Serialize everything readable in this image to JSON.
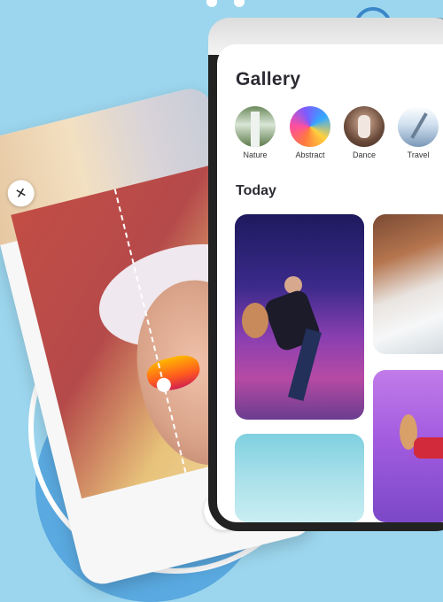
{
  "gallery": {
    "title": "Gallery",
    "today_label": "Today",
    "categories": [
      {
        "label": "Nature",
        "icon": "nature-thumbnail"
      },
      {
        "label": "Abstract",
        "icon": "abstract-thumbnail"
      },
      {
        "label": "Dance",
        "icon": "dance-thumbnail"
      },
      {
        "label": "Travel",
        "icon": "travel-thumbnail"
      }
    ],
    "photos": [
      {
        "name": "dancer-night-street-photo"
      },
      {
        "name": "rock-snow-landscape-photo"
      },
      {
        "name": "sky-water-photo"
      },
      {
        "name": "dancer-purple-photo"
      }
    ]
  },
  "editor": {
    "close_icon": "×",
    "tools": [
      "magic-face-icon",
      "aperture-icon"
    ]
  },
  "colors": {
    "background": "#9cd6ee",
    "accent_blue": "#3a86c8",
    "title_text": "#2b2b33"
  }
}
